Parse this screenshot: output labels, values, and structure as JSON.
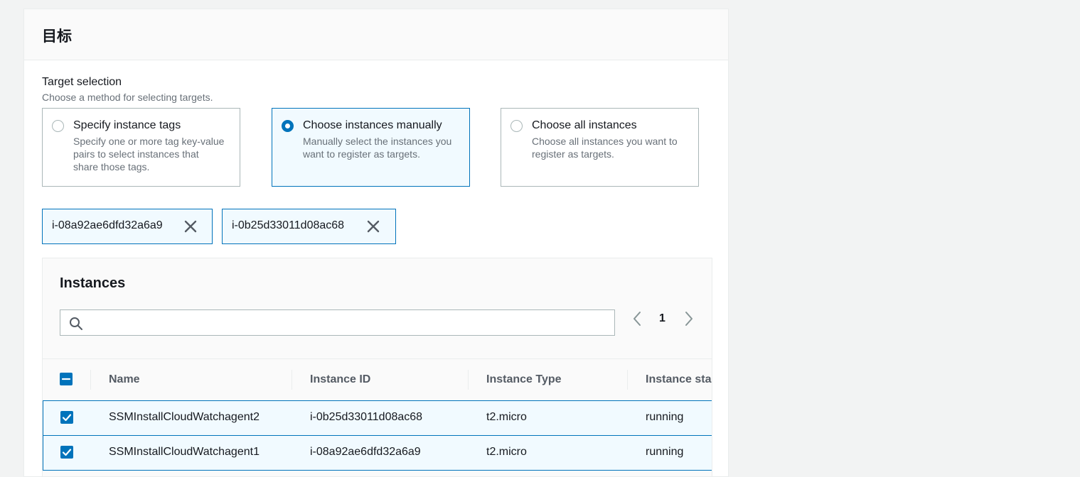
{
  "panel": {
    "title": "目标"
  },
  "target_selection": {
    "label": "Target selection",
    "description": "Choose a method for selecting targets.",
    "options": [
      {
        "title": "Specify instance tags",
        "description": "Specify one or more tag key-value pairs to select instances that share those tags.",
        "selected": false
      },
      {
        "title": "Choose instances manually",
        "description": "Manually select the instances you want to register as targets.",
        "selected": true
      },
      {
        "title": "Choose all instances",
        "description": "Choose all instances you want to register as targets.",
        "selected": false
      }
    ]
  },
  "tokens": [
    {
      "label": "i-08a92ae6dfd32a6a9",
      "icon": "close-icon"
    },
    {
      "label": "i-0b25d33011d08ac68",
      "icon": "close-icon"
    }
  ],
  "instances": {
    "title": "Instances",
    "search": {
      "value": "",
      "placeholder": ""
    },
    "pagination": {
      "current_page": "1"
    },
    "columns": [
      "Name",
      "Instance ID",
      "Instance Type",
      "Instance sta"
    ],
    "rows": [
      {
        "checked": true,
        "name": "SSMInstallCloudWatchagent2",
        "instance_id": "i-0b25d33011d08ac68",
        "instance_type": "t2.micro",
        "state": "running"
      },
      {
        "checked": true,
        "name": "SSMInstallCloudWatchagent1",
        "instance_id": "i-08a92ae6dfd32a6a9",
        "instance_type": "t2.micro",
        "state": "running"
      }
    ]
  },
  "colors": {
    "accent": "#0073bb",
    "selected_bg": "#f1faff",
    "page_bg": "#f2f3f3",
    "muted_text": "#687078"
  }
}
